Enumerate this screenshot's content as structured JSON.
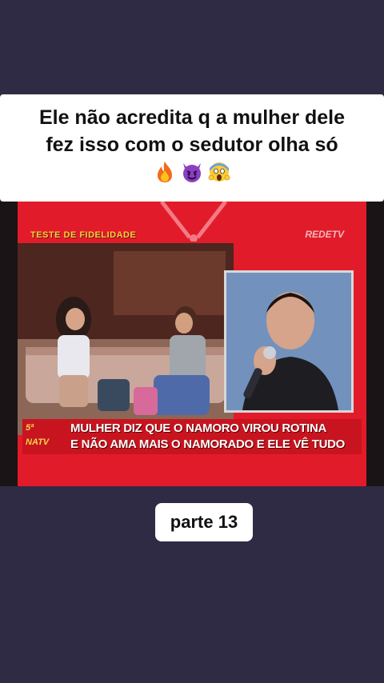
{
  "caption": {
    "line1": "Ele não acredita q a mulher dele",
    "line2": "fez isso com o sedutor olha só",
    "emojis": [
      "fire-emoji",
      "smiling-devil-emoji",
      "screaming-face-emoji"
    ]
  },
  "video": {
    "program_label": "TESTE DE FIDELIDADE",
    "channel_logo": "REDETV",
    "ticker_badge_line1": "5ª",
    "ticker_badge_line2": "NATV",
    "ticker_line1": "MULHER DIZ QUE O NAMORO VIROU ROTINA",
    "ticker_line2": "E NÃO AMA MAIS O NAMORADO E ELE VÊ TUDO"
  },
  "part_label": "parte 13",
  "colors": {
    "background": "#2f2b45",
    "tv_red": "#e21b2a",
    "ticker_red": "#c8141f",
    "label_yellow": "#f3d23a"
  }
}
